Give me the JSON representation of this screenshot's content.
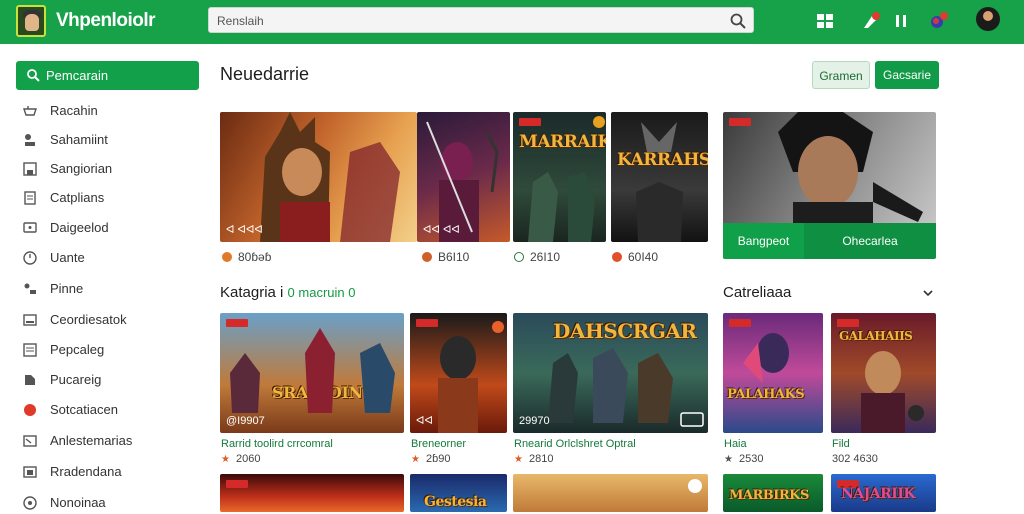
{
  "topbar": {
    "app_title": "Vhpenloiolr",
    "search_value": "Renslaih",
    "icons": [
      "grid-icon",
      "notifications-icon",
      "pause-icon",
      "achievements-icon"
    ]
  },
  "sidebar": {
    "search_label": "Pemcarain",
    "items": [
      {
        "label": "Racahin",
        "icon": "gamepad-icon"
      },
      {
        "label": "Sahamiint",
        "icon": "joystick-icon"
      },
      {
        "label": "Sangiorian",
        "icon": "save-icon"
      },
      {
        "label": "Catplians",
        "icon": "document-icon"
      },
      {
        "label": "Daigeelod",
        "icon": "chat-icon"
      },
      {
        "label": "Uante",
        "icon": "clock-icon"
      },
      {
        "label": "Pinne",
        "icon": "controller-icon"
      },
      {
        "label": "Ceordiesatok",
        "icon": "mail-icon"
      },
      {
        "label": "Pepcaleg",
        "icon": "list-icon"
      },
      {
        "label": "Pucareig",
        "icon": "tag-icon"
      },
      {
        "label": "Sotcatiacen",
        "icon": "record-icon"
      },
      {
        "label": "Anlestemarias",
        "icon": "message-icon"
      },
      {
        "label": "Rradendana",
        "icon": "bookmark-icon"
      },
      {
        "label": "Nonoinaa",
        "icon": "target-icon"
      }
    ]
  },
  "main": {
    "title": "Neuedarrie",
    "btn_light": "Gramen",
    "btn_green": "Gacsarie",
    "featured": [
      {
        "caption": "ᐊ ᐊᐊᐊ",
        "meta": "80ɓəɓ"
      },
      {
        "caption": "ᐊᐊ ᐊᐊ",
        "meta": "B6I10"
      },
      {
        "title": "MARRAIK",
        "meta": "26I10"
      },
      {
        "title": "KARRAHS",
        "meta": "60I40"
      }
    ],
    "hero_btn1": "Bangpeot",
    "hero_btn2": "Ohecarlea",
    "kategori": {
      "title": "Katagria i",
      "extra": "macruin",
      "extra_icon_left": "0",
      "extra_icon_right": "0"
    },
    "catalog_title": "Catreliaaa",
    "grid": [
      {
        "title": "SRAGIOIN",
        "caption": "@I9907",
        "label": "Rarrid toolird crrcomral",
        "meta": "2060"
      },
      {
        "title": "",
        "caption": "ᐊᐊ",
        "label": "Breneorner",
        "meta": "2ɓ90"
      },
      {
        "title": "DAHSCRGAR",
        "caption": "29970",
        "label": "Rnearid Orlclshret Optral",
        "meta": "2810"
      },
      {
        "title": "PALAHAKS",
        "caption": "",
        "label": "Haia",
        "meta": "2530"
      },
      {
        "title": "GALAHAIIS",
        "caption": "",
        "label": "Fild",
        "meta": "302 4630"
      }
    ],
    "bottom": [
      {
        "title": ""
      },
      {
        "title": "Gestesia"
      },
      {
        "title": ""
      },
      {
        "title": "MARBIRKS"
      },
      {
        "title": "NAJARIIK"
      }
    ]
  },
  "colors": {
    "brand": "#17a24a",
    "accent_dark": "#119a47"
  }
}
